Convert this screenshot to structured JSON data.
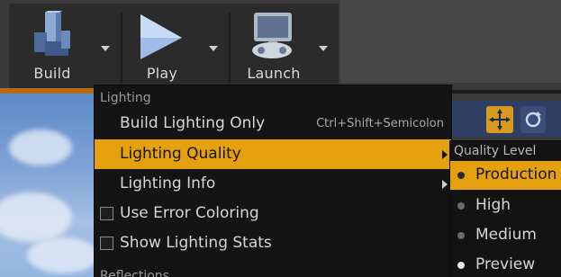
{
  "toolbar": {
    "build_label": "Build",
    "play_label": "Play",
    "launch_label": "Launch"
  },
  "menu": {
    "section_lighting": "Lighting",
    "items": [
      {
        "label": "Build Lighting Only",
        "shortcut": "Ctrl+Shift+Semicolon"
      },
      {
        "label": "Lighting Quality",
        "highlighted": true,
        "has_submenu": true
      },
      {
        "label": "Lighting Info",
        "has_submenu": true
      },
      {
        "label": "Use Error Coloring",
        "checkbox": false
      },
      {
        "label": "Show Lighting Stats",
        "checkbox": false
      }
    ],
    "section_reflections": "Reflections"
  },
  "submenu": {
    "title": "Quality Level",
    "options": [
      {
        "label": "Production",
        "selected": true
      },
      {
        "label": "High"
      },
      {
        "label": "Medium"
      },
      {
        "label": "Preview"
      }
    ]
  },
  "colors": {
    "accent": "#e5a00d",
    "menu_bg": "#141414",
    "toolbar_bg": "#2b2b2b"
  },
  "icons": [
    "build-icon",
    "play-icon",
    "launch-icon",
    "chevron-down-icon",
    "chevron-right-icon",
    "checkbox-icon",
    "radio-icon",
    "move-tool-icon",
    "rotate-tool-icon"
  ]
}
